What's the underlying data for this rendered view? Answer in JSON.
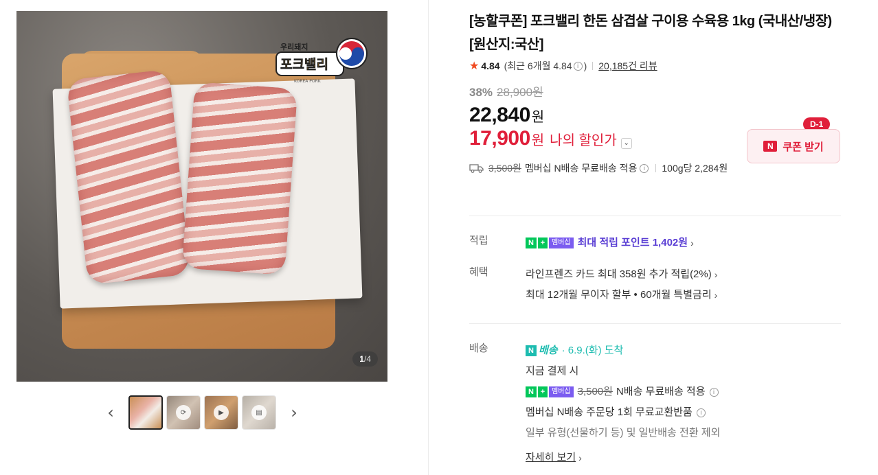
{
  "gallery": {
    "brand_logo_text": "포크밸리",
    "brand_logo_sub": "우리돼지",
    "brand_logo_en": "KOREA PORK",
    "counter_current": "1",
    "counter_total": "/4"
  },
  "product": {
    "title": "[농할쿠폰] 포크밸리 한돈 삼겹살 구이용 수육용 1kg (국내산/냉장) [원산지:국산]",
    "rating": "4.84",
    "rating_recent": "(최근 6개월 4.84",
    "rating_recent_close": ")",
    "review_count": "20,185건 리뷰",
    "discount_rate": "38%",
    "original_price": "28,900원",
    "price": "22,840",
    "price_unit": "원",
    "my_price": "17,900",
    "my_price_unit": "원",
    "my_price_label": "나의 할인가",
    "coupon_badge": "D-1",
    "coupon_label": "쿠폰 받기",
    "shipping_fee": "3,500원",
    "shipping_text": "멤버십 N배송 무료배송 적용",
    "unit_price": "100g당 2,284원"
  },
  "details": {
    "points_label": "적립",
    "membership_tag": "멤버십",
    "points_text": "최대 적립 포인트 1,402원",
    "benefit_label": "혜택",
    "benefit_1": "라인프렌즈 카드 최대 358원 추가 적립(2%)",
    "benefit_2": "최대 12개월 무이자 할부 • 60개월 특별금리",
    "delivery_label": "배송",
    "nbaesong_label": "배송",
    "arrival": "· 6.9.(화) 도착",
    "pay_now": "지금 결제 시",
    "free_fee": "3,500원",
    "free_text": "N배송 무료배송 적용",
    "exchange_text": "멤버십 N배송 주문당 1회 무료교환반품",
    "exclusion_text": "일부 유형(선물하기 등) 및 일반배송 전환 제외",
    "more_link": "자세히 보기"
  },
  "colors": {
    "accent_red": "#e01f3a",
    "membership_green": "#03c75a",
    "membership_purple": "#7b5cf0",
    "delivery_teal": "#1dbcb0",
    "star": "#f04a20"
  }
}
